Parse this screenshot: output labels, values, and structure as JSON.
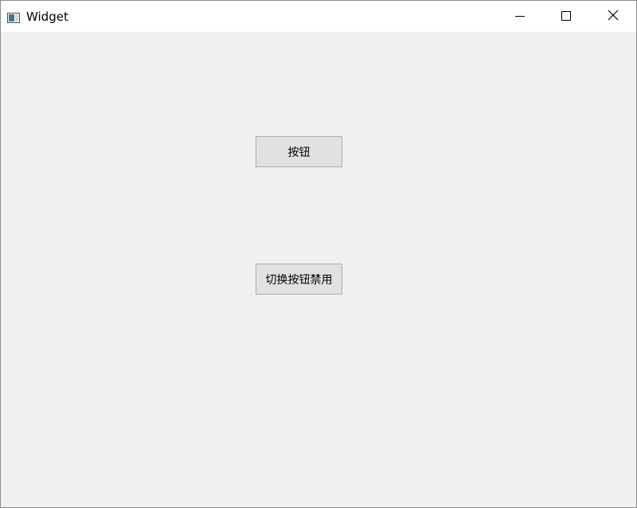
{
  "window": {
    "title": "Widget"
  },
  "buttons": {
    "primary_label": "按钮",
    "toggle_label": "切换按钮禁用"
  },
  "icons": {
    "app": "app-window-icon",
    "minimize": "minimize-icon",
    "maximize": "maximize-icon",
    "close": "close-icon"
  }
}
